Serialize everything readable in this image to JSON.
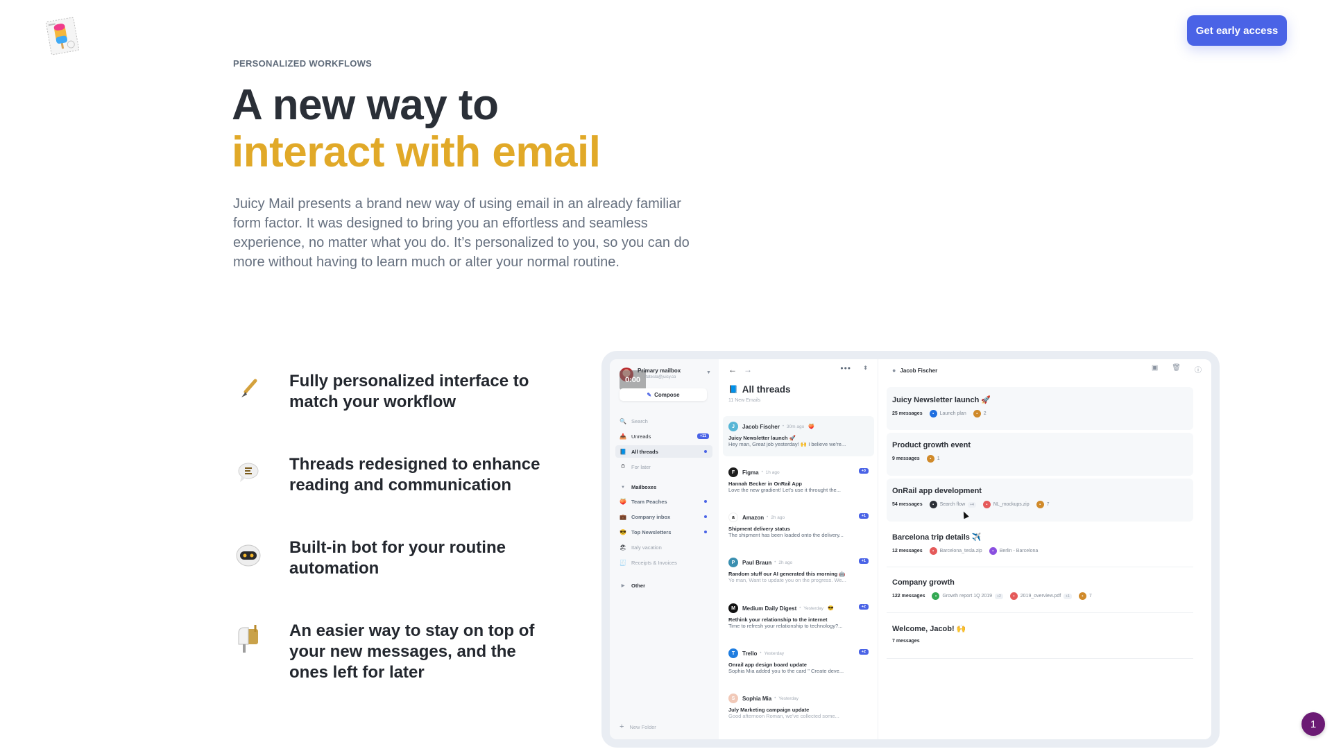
{
  "header": {
    "logo_icon": "popsicle-stamp-icon",
    "cta_label": "Get early access"
  },
  "hero": {
    "eyebrow": "PERSONALIZED WORKFLOWS",
    "title_line1": "A new way to",
    "title_line2": "interact with email",
    "lead": "Juicy Mail presents a brand new way of using email in an already familiar form factor. It was designed to bring you an effortless and seamless experience, no matter what you do. It’s personalized to you, so you can do more without having to learn much or alter your normal routine.",
    "accent_color": "#e1a928"
  },
  "features": [
    {
      "icon": "paintbrush-icon",
      "glyph": "🖌️",
      "text": "Fully personalized interface to match your workflow"
    },
    {
      "icon": "speech-bubble-icon",
      "glyph": "💬",
      "text": "Threads redesigned to enhance reading and communication"
    },
    {
      "icon": "bot-icon",
      "glyph": "🤖",
      "text": "Built-in bot for your routine automation"
    },
    {
      "icon": "mailbox-icon",
      "glyph": "📬",
      "text": "An easier way to stay on top of your new messages, and the ones left for later"
    }
  ],
  "app": {
    "account": {
      "name": "Primary mailbox",
      "email": "rtatesla@juicy.co",
      "overlay_text": "0:00"
    },
    "compose_label": "Compose",
    "nav": [
      {
        "label": "Search",
        "glyph": "🔍",
        "muted": true
      },
      {
        "label": "Unreads",
        "glyph": "📥",
        "badge": "+11"
      },
      {
        "label": "All threads",
        "glyph": "📘",
        "active": true,
        "dot": true
      },
      {
        "label": "For later",
        "glyph": "⏱",
        "muted": true
      }
    ],
    "mailboxes_label": "Mailboxes",
    "mailboxes": [
      {
        "label": "Team Peaches",
        "glyph": "🍑",
        "dot": true
      },
      {
        "label": "Company inbox",
        "glyph": "💼",
        "dot": true
      },
      {
        "label": "Top Newsletters",
        "glyph": "😎",
        "dot": true
      },
      {
        "label": "Italy vacation",
        "glyph": "🏖",
        "muted": true
      },
      {
        "label": "Receipts & Invoices",
        "glyph": "🧾",
        "muted": true
      }
    ],
    "other_label": "Other",
    "new_folder_label": "New Folder",
    "list": {
      "title": "All threads",
      "title_glyph": "📘",
      "subtitle": "11 New Emails",
      "threads": [
        {
          "sender": "Jacob Fischer",
          "time": "30m ago",
          "emoji": "🍑",
          "subject": "Juicy Newsletter launch 🚀",
          "preview": "Hey man, Great job yesterday! 🙌 I believe we're...",
          "avatar_color": "#57b6d6",
          "avatar_text": "J",
          "selected": true
        },
        {
          "sender": "Figma",
          "time": "1h ago",
          "count": "+3",
          "subject": "Hannah Becker in OnRail App",
          "preview": "Love the new gradient! Let's use it throught the...",
          "avatar_color": "#1e1e1e",
          "avatar_text": "F"
        },
        {
          "sender": "Amazon",
          "time": "2h ago",
          "count": "+1",
          "subject": "Shipment delivery status",
          "preview": "The shipment has been loaded onto the delivery...",
          "avatar_color": "#ffffff",
          "avatar_text": "a"
        },
        {
          "sender": "Paul Braun",
          "time": "2h ago",
          "count": "+1",
          "subject": "Random stuff our AI generated this morning 🤖",
          "preview": "Yo man, Want to update you on the progress. We...",
          "avatar_color": "#3a8fb0",
          "avatar_text": "P",
          "faded": true
        },
        {
          "sender": "Medium Daily Digest",
          "time": "Yesterday",
          "emoji": "😎",
          "count": "+2",
          "subject": "Rethink your relationship to the internet",
          "preview": "Time to refresh your relationship to technology?...",
          "avatar_color": "#111111",
          "avatar_text": "M"
        },
        {
          "sender": "Trello",
          "time": "Yesterday",
          "count": "+2",
          "subject": "Onrail app design board update",
          "preview": "Sophia Mia added you to the card \" Create deve...",
          "avatar_color": "#1f7de0",
          "avatar_text": "T"
        },
        {
          "sender": "Sophia Mia",
          "time": "Yesterday",
          "subject": "July Marketing campaign update",
          "preview": "Good afternoon Roman, we've collected some...",
          "avatar_color": "#f1c9b8",
          "avatar_text": "S",
          "faded": true
        }
      ]
    },
    "detail": {
      "contact": "Jacob Fischer",
      "conversations": [
        {
          "title": "Juicy Newsletter launch 🚀",
          "count": "25 messages",
          "chips": [
            {
              "label": "Launch plan",
              "color": "#1f6fe0"
            },
            {
              "label": "2",
              "color": "#d08a2a"
            }
          ],
          "style": "tinted"
        },
        {
          "title": "Product growth event",
          "count": "9 messages",
          "chips": [
            {
              "label": "1",
              "color": "#d08a2a"
            }
          ],
          "style": "tinted"
        },
        {
          "title": "OnRail app development",
          "count": "54 messages",
          "chips": [
            {
              "label": "Search flow",
              "color": "#2b2f36",
              "plus": "+4"
            },
            {
              "label": "NL_mockups.zip",
              "color": "#e55a5a"
            },
            {
              "label": "7",
              "color": "#d08a2a"
            }
          ],
          "style": "tinted"
        },
        {
          "title": "Barcelona trip details ✈️",
          "count": "12 messages",
          "chips": [
            {
              "label": "Barcelona_tesla.zip",
              "color": "#e55a5a"
            },
            {
              "label": "Berlin - Barcelona",
              "color": "#8a4fe0"
            }
          ],
          "style": "lined"
        },
        {
          "title": "Company growth",
          "count": "122 messages",
          "chips": [
            {
              "label": "Growth report 1Q 2019",
              "color": "#33a852",
              "plus": "+2"
            },
            {
              "label": "2019_overview.pdf",
              "color": "#e55a5a",
              "plus": "+1"
            },
            {
              "label": "7",
              "color": "#d08a2a"
            }
          ],
          "style": "lined"
        },
        {
          "title": "Welcome, Jacob! 🙌",
          "count": "7 messages",
          "chips": [],
          "style": "lined"
        }
      ]
    }
  },
  "chat_badge": "1"
}
